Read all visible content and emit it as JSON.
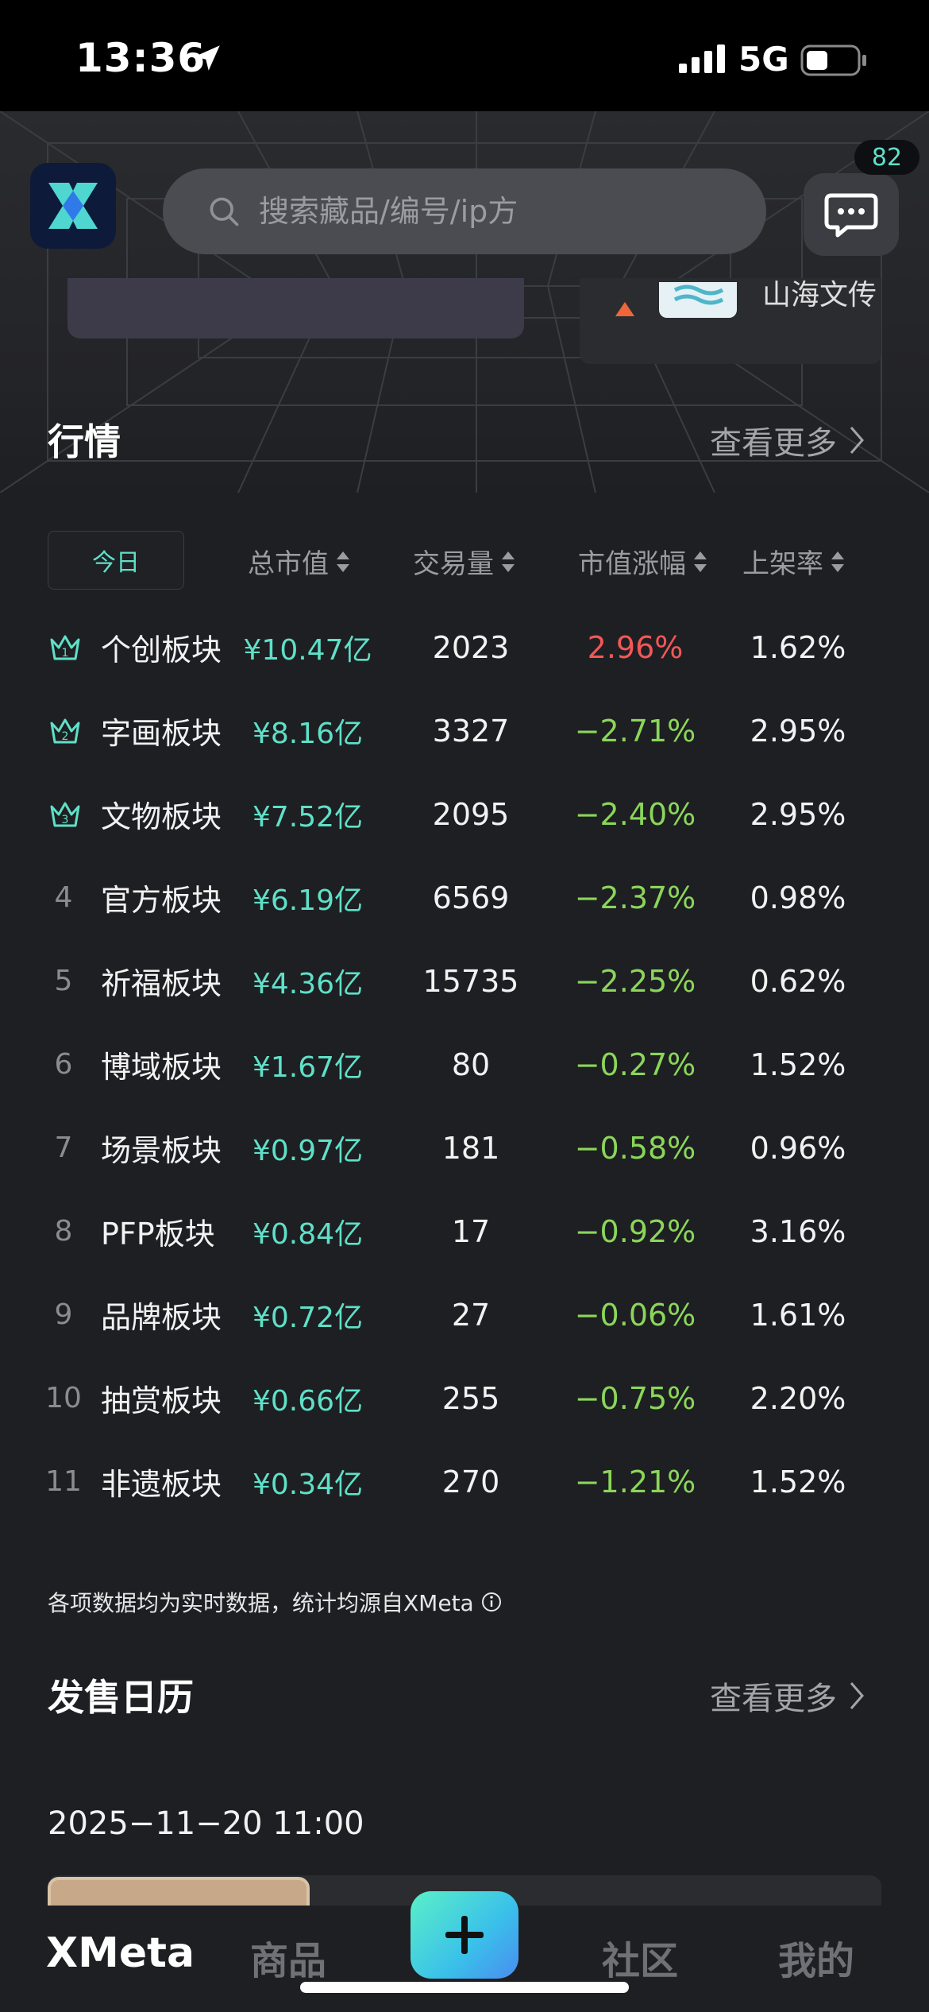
{
  "status_bar": {
    "time": "13:36",
    "network": "5G"
  },
  "header": {
    "search_placeholder": "搜索藏品/编号/ip方",
    "message_badge": "82",
    "banner_right_text": "山海文传"
  },
  "market": {
    "title": "行情",
    "see_more": "查看更多",
    "period_tab": "今日",
    "columns": [
      "总市值",
      "交易量",
      "市值涨幅",
      "上架率"
    ],
    "rows": [
      {
        "rank": "1",
        "name": "个创板块",
        "market_cap": "¥10.47亿",
        "volume": "2023",
        "change": "2.96%",
        "direction": "up",
        "listing_rate": "1.62%"
      },
      {
        "rank": "2",
        "name": "字画板块",
        "market_cap": "¥8.16亿",
        "volume": "3327",
        "change": "−2.71%",
        "direction": "down",
        "listing_rate": "2.95%"
      },
      {
        "rank": "3",
        "name": "文物板块",
        "market_cap": "¥7.52亿",
        "volume": "2095",
        "change": "−2.40%",
        "direction": "down",
        "listing_rate": "2.95%"
      },
      {
        "rank": "4",
        "name": "官方板块",
        "market_cap": "¥6.19亿",
        "volume": "6569",
        "change": "−2.37%",
        "direction": "down",
        "listing_rate": "0.98%"
      },
      {
        "rank": "5",
        "name": "祈福板块",
        "market_cap": "¥4.36亿",
        "volume": "15735",
        "change": "−2.25%",
        "direction": "down",
        "listing_rate": "0.62%"
      },
      {
        "rank": "6",
        "name": "博域板块",
        "market_cap": "¥1.67亿",
        "volume": "80",
        "change": "−0.27%",
        "direction": "down",
        "listing_rate": "1.52%"
      },
      {
        "rank": "7",
        "name": "场景板块",
        "market_cap": "¥0.97亿",
        "volume": "181",
        "change": "−0.58%",
        "direction": "down",
        "listing_rate": "0.96%"
      },
      {
        "rank": "8",
        "name": "PFP板块",
        "market_cap": "¥0.84亿",
        "volume": "17",
        "change": "−0.92%",
        "direction": "down",
        "listing_rate": "3.16%"
      },
      {
        "rank": "9",
        "name": "品牌板块",
        "market_cap": "¥0.72亿",
        "volume": "27",
        "change": "−0.06%",
        "direction": "down",
        "listing_rate": "1.61%"
      },
      {
        "rank": "10",
        "name": "抽赏板块",
        "market_cap": "¥0.66亿",
        "volume": "255",
        "change": "−0.75%",
        "direction": "down",
        "listing_rate": "2.20%"
      },
      {
        "rank": "11",
        "name": "非遗板块",
        "market_cap": "¥0.34亿",
        "volume": "270",
        "change": "−1.21%",
        "direction": "down",
        "listing_rate": "1.52%"
      }
    ],
    "note": "各项数据均为实时数据，统计均源自XMeta"
  },
  "calendar": {
    "title": "发售日历",
    "see_more": "查看更多",
    "date": "2025−11−20 11:00"
  },
  "tabbar": {
    "items": [
      "XMeta",
      "商品",
      "社区",
      "我的"
    ]
  },
  "colors": {
    "accent": "#5fe0c8",
    "up": "#f25757",
    "down": "#8bd65a"
  }
}
